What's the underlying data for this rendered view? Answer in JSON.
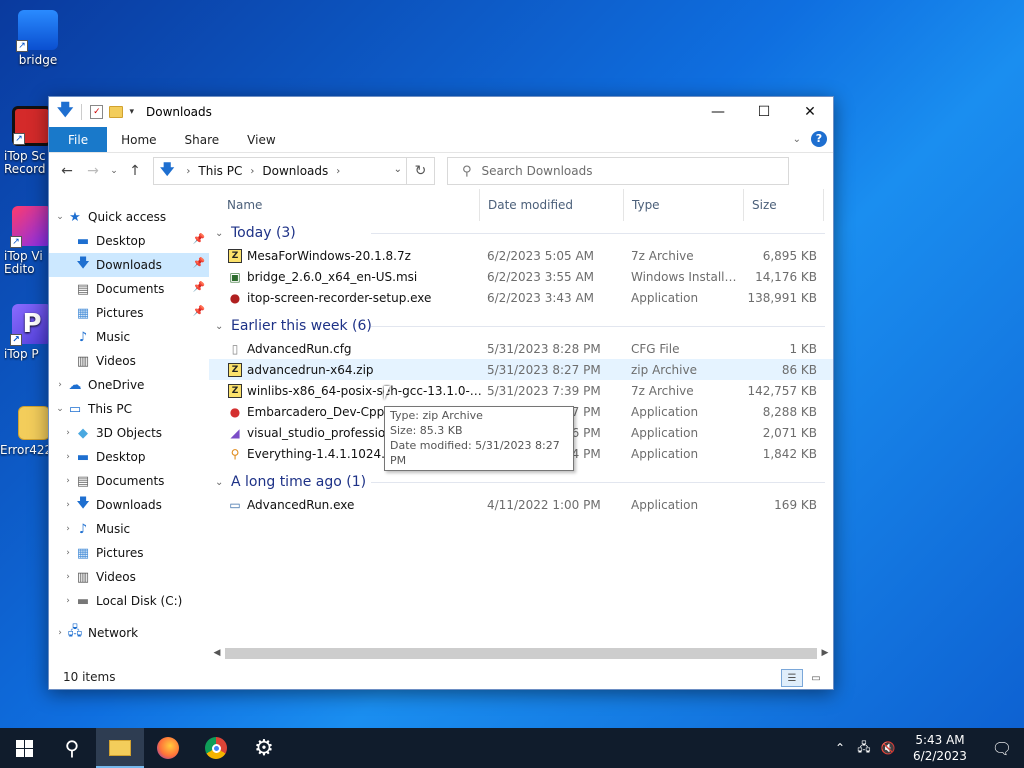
{
  "desktop": {
    "icons": [
      {
        "label": "bridge"
      },
      {
        "label": "iTop Sc\nRecord"
      },
      {
        "label": "iTop Vi\nEdito"
      },
      {
        "label": "iTop P"
      },
      {
        "label": "Error422_"
      }
    ]
  },
  "window": {
    "title": "Downloads",
    "ribbon": {
      "tabs": [
        "File",
        "Home",
        "Share",
        "View"
      ]
    },
    "address": {
      "crumbs": [
        "This PC",
        "Downloads"
      ]
    },
    "search": {
      "placeholder": "Search Downloads"
    }
  },
  "nav_pane": {
    "items": [
      {
        "label": "Quick access",
        "icon": "star-icon",
        "level": 0,
        "expand": "expanded"
      },
      {
        "label": "Desktop",
        "icon": "desktop-icon",
        "level": 1,
        "pinned": true
      },
      {
        "label": "Downloads",
        "icon": "download-icon",
        "level": 1,
        "pinned": true,
        "selected": true
      },
      {
        "label": "Documents",
        "icon": "document-icon",
        "level": 1,
        "pinned": true
      },
      {
        "label": "Pictures",
        "icon": "pictures-icon",
        "level": 1,
        "pinned": true
      },
      {
        "label": "Music",
        "icon": "music-icon",
        "level": 1
      },
      {
        "label": "Videos",
        "icon": "videos-icon",
        "level": 1
      },
      {
        "label": "OneDrive",
        "icon": "cloud-icon",
        "level": 0,
        "expand": "collapsed"
      },
      {
        "label": "This PC",
        "icon": "pc-icon",
        "level": 0,
        "expand": "expanded"
      },
      {
        "label": "3D Objects",
        "icon": "cube-icon",
        "level": 1,
        "expand": "collapsed"
      },
      {
        "label": "Desktop",
        "icon": "desktop-icon",
        "level": 1,
        "expand": "collapsed"
      },
      {
        "label": "Documents",
        "icon": "document-icon",
        "level": 1,
        "expand": "collapsed"
      },
      {
        "label": "Downloads",
        "icon": "download-icon",
        "level": 1,
        "expand": "collapsed"
      },
      {
        "label": "Music",
        "icon": "music-icon",
        "level": 1,
        "expand": "collapsed"
      },
      {
        "label": "Pictures",
        "icon": "pictures-icon",
        "level": 1,
        "expand": "collapsed"
      },
      {
        "label": "Videos",
        "icon": "videos-icon",
        "level": 1,
        "expand": "collapsed"
      },
      {
        "label": "Local Disk (C:)",
        "icon": "disk-icon",
        "level": 1,
        "expand": "collapsed"
      },
      {
        "label": "Network",
        "icon": "network-icon",
        "level": 0,
        "expand": "collapsed",
        "gap": true
      }
    ]
  },
  "columns": {
    "name": "Name",
    "date": "Date modified",
    "type": "Type",
    "size": "Size"
  },
  "groups": [
    {
      "title": "Today (3)",
      "files": [
        {
          "name": "MesaForWindows-20.1.8.7z",
          "date": "6/2/2023 5:05 AM",
          "type": "7z Archive",
          "size": "6,895 KB",
          "icon": "archive-icon"
        },
        {
          "name": "bridge_2.6.0_x64_en-US.msi",
          "date": "6/2/2023 3:55 AM",
          "type": "Windows Installer ...",
          "size": "14,176 KB",
          "icon": "installer-icon"
        },
        {
          "name": "itop-screen-recorder-setup.exe",
          "date": "6/2/2023 3:43 AM",
          "type": "Application",
          "size": "138,991 KB",
          "icon": "app-icon"
        }
      ]
    },
    {
      "title": "Earlier this week (6)",
      "files": [
        {
          "name": "AdvancedRun.cfg",
          "date": "5/31/2023 8:28 PM",
          "type": "CFG File",
          "size": "1 KB",
          "icon": "file-icon"
        },
        {
          "name": "advancedrun-x64.zip",
          "date": "5/31/2023 8:27 PM",
          "type": "zip Archive",
          "size": "86 KB",
          "icon": "archive-icon",
          "hover": true
        },
        {
          "name": "winlibs-x86_64-posix-seh-gcc-13.1.0-llv...",
          "date": "5/31/2023 7:39 PM",
          "type": "7z Archive",
          "size": "142,757 KB",
          "icon": "archive-icon"
        },
        {
          "name": "Embarcadero_Dev-Cpp_6.3_TDM-GCC_9.2_Setup.exe",
          "date": "5/31/2023 7:37 PM",
          "type": "Application",
          "size": "8,288 KB",
          "icon": "devcpp-icon"
        },
        {
          "name": "visual_studio_professional.exe",
          "date": "5/31/2023 7:36 PM",
          "type": "Application",
          "size": "2,071 KB",
          "icon": "vs-icon"
        },
        {
          "name": "Everything-1.4.1.1024.x64-Setup.exe",
          "date": "5/31/2023 7:34 PM",
          "type": "Application",
          "size": "1,842 KB",
          "icon": "search-app-icon"
        }
      ]
    },
    {
      "title": "A long time ago (1)",
      "files": [
        {
          "name": "AdvancedRun.exe",
          "date": "4/11/2022 1:00 PM",
          "type": "Application",
          "size": "169 KB",
          "icon": "window-app-icon"
        }
      ]
    }
  ],
  "tooltip": {
    "line1": "Type: zip Archive",
    "line2": "Size: 85.3 KB",
    "line3": "Date modified: 5/31/2023 8:27 PM"
  },
  "status": {
    "count": "10 items"
  },
  "taskbar": {
    "time": "5:43 AM",
    "date": "6/2/2023"
  }
}
